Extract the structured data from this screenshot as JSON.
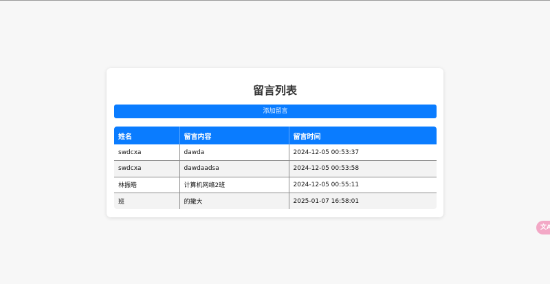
{
  "page": {
    "title": "留言列表",
    "add_button_label": "添加留言"
  },
  "table": {
    "headers": [
      "姓名",
      "留言内容",
      "留言时间"
    ],
    "rows": [
      [
        "swdcxa",
        "dawda",
        "2024-12-05 00:53:37"
      ],
      [
        "swdcxa",
        "dawdaadsa",
        "2024-12-05 00:53:58"
      ],
      [
        "林振皓",
        "计算机网络2班",
        "2024-12-05 00:55:11"
      ],
      [
        "班",
        "的撒大",
        "2025-01-07 16:58:01"
      ]
    ]
  },
  "widget": {
    "icon": "translate-icon",
    "glyph": "文A"
  },
  "colors": {
    "accent": "#0a7cff",
    "background": "#f7f7f7",
    "widget": "#f3a8c6"
  }
}
